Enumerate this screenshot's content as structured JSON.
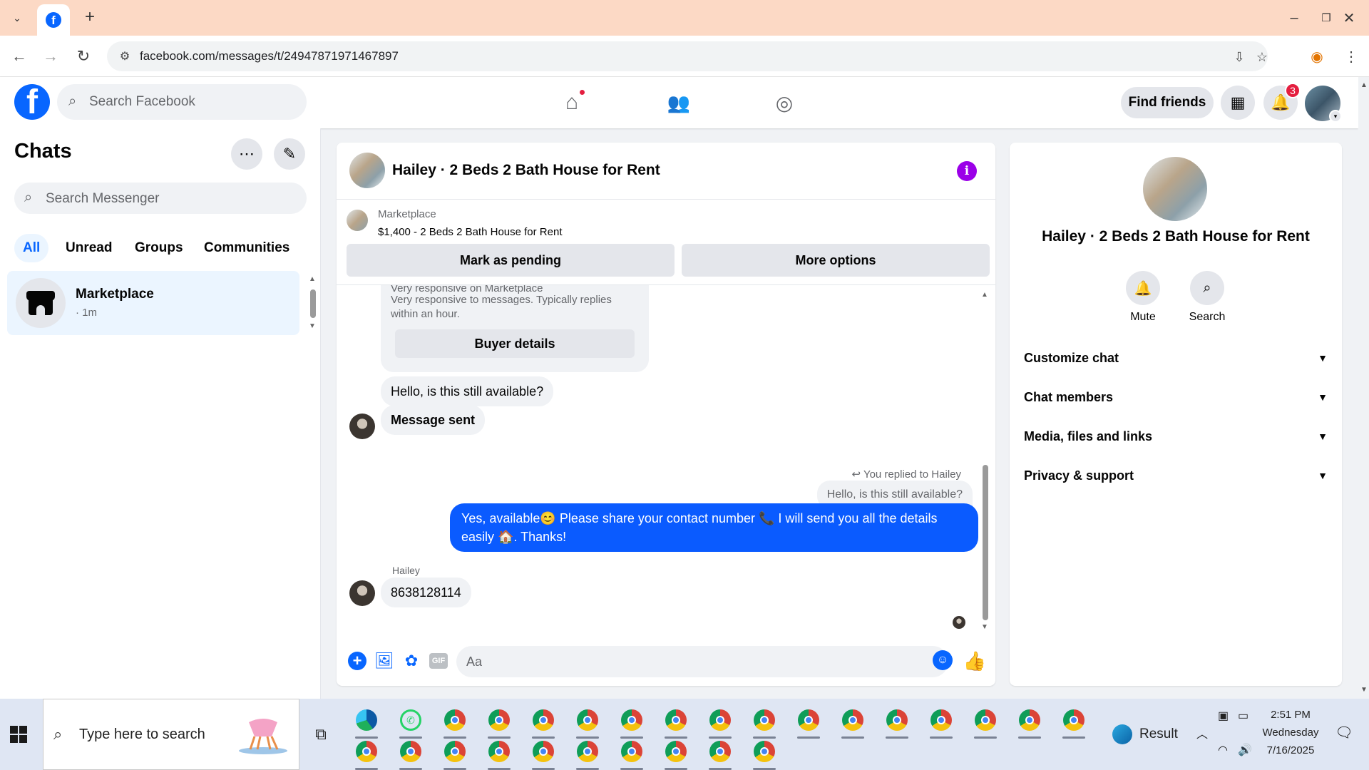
{
  "browser": {
    "url": "facebook.com/messages/t/24947871971467897"
  },
  "fbnav": {
    "search_placeholder": "Search Facebook",
    "find_friends": "Find friends",
    "notification_count": "3"
  },
  "chats": {
    "title": "Chats",
    "search_placeholder": "Search Messenger",
    "filters": [
      "All",
      "Unread",
      "Groups",
      "Communities"
    ],
    "items": [
      {
        "name": "Marketplace",
        "time": "· 1m"
      }
    ]
  },
  "conversation": {
    "title": "Hailey · 2 Beds 2 Bath House for Rent",
    "marketplace_label": "Marketplace",
    "listing": "$1,400 - 2 Beds 2 Bath House for Rent",
    "mark_pending": "Mark as pending",
    "more_options": "More options",
    "seller_card_line1": "Very responsive on Marketplace",
    "seller_card_line2": "Very responsive to messages. Typically replies within an hour.",
    "buyer_details": "Buyer details",
    "msg_available": "Hello, is this still available?",
    "msg_sent": "Message sent",
    "reply_note": "You replied to Hailey",
    "quoted": "Hello, is this still available?",
    "outgoing": "Yes, available😊 Please share your contact number 📞 I will send you all the details easily 🏠. Thanks!",
    "sender_label": "Hailey",
    "incoming_number": "8638128114",
    "composer_placeholder": "Aa"
  },
  "info_panel": {
    "name": "Hailey · 2 Beds 2 Bath House for Rent",
    "actions": [
      "Mute",
      "Search"
    ],
    "sections": [
      "Customize chat",
      "Chat members",
      "Media, files and links",
      "Privacy & support"
    ]
  },
  "taskbar": {
    "search_placeholder": "Type here to search",
    "result_label": "Result",
    "time": "2:51 PM",
    "day": "Wednesday",
    "date": "7/16/2025"
  },
  "colors": {
    "fb_blue": "#0866ff",
    "outgoing_bubble": "#0a5bff",
    "info_purple": "#9b00e8",
    "badge_red": "#e41e3f"
  }
}
